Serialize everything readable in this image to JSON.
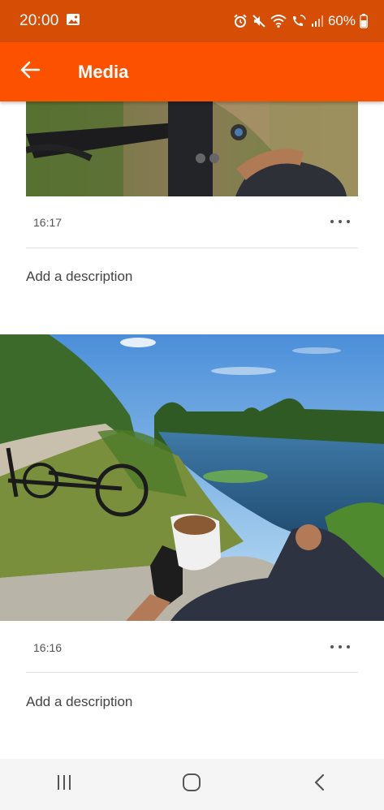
{
  "status_bar": {
    "time": "20:00",
    "battery": "60%",
    "icons": [
      "gallery-icon",
      "alarm-icon",
      "mute-icon",
      "wifi-icon",
      "wifi-calling-icon",
      "signal-icon",
      "battery-icon"
    ]
  },
  "app_bar": {
    "title": "Media",
    "back_icon": "arrow-left-icon",
    "color": "#fc5200"
  },
  "media_items": [
    {
      "time": "16:17",
      "description_placeholder": "Add a description"
    },
    {
      "time": "16:16",
      "description_placeholder": "Add a description"
    }
  ],
  "nav_bar": {
    "icons": [
      "recent-apps-icon",
      "home-icon",
      "back-icon"
    ]
  }
}
